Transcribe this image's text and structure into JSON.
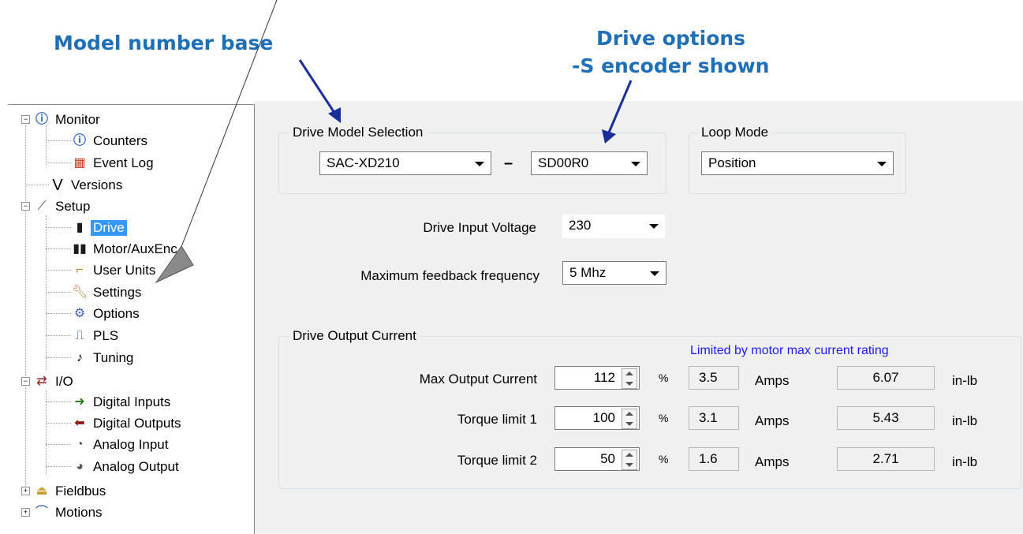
{
  "annotations": {
    "model_base": "Model number base",
    "drive_options_line1": "Drive options",
    "drive_options_line2": "-S encoder shown"
  },
  "tree": {
    "monitor": "Monitor",
    "counters": "Counters",
    "event_log": "Event Log",
    "versions": "Versions",
    "setup": "Setup",
    "drive": "Drive",
    "motor_auxenc": "Motor/AuxEnc",
    "user_units": "User Units",
    "settings": "Settings",
    "options": "Options",
    "pls": "PLS",
    "tuning": "Tuning",
    "io": "I/O",
    "digital_inputs": "Digital Inputs",
    "digital_outputs": "Digital Outputs",
    "analog_input": "Analog Input",
    "analog_output": "Analog Output",
    "fieldbus": "Fieldbus",
    "motions": "Motions",
    "selected": "Drive"
  },
  "drive_model": {
    "title": "Drive Model Selection",
    "model": "SAC-XD210",
    "dash": "–",
    "option": "SD00R0"
  },
  "loop_mode": {
    "title": "Loop Mode",
    "value": "Position"
  },
  "input_voltage": {
    "label": "Drive Input Voltage",
    "value": "230"
  },
  "feedback_freq": {
    "label": "Maximum feedback frequency",
    "value": "5 Mhz"
  },
  "output_current": {
    "title": "Drive Output Current",
    "note": "Limited by motor max current rating",
    "note_color": "#1a1aff",
    "pct_unit": "%",
    "amps_unit": "Amps",
    "torque_unit": "in-lb",
    "rows": [
      {
        "label": "Max Output Current",
        "percent": "112",
        "amps": "3.5",
        "torque": "6.07"
      },
      {
        "label": "Torque limit 1",
        "percent": "100",
        "amps": "3.1",
        "torque": "5.43"
      },
      {
        "label": "Torque limit 2",
        "percent": "50",
        "amps": "1.6",
        "torque": "2.71"
      }
    ]
  },
  "colors": {
    "annotation": "#1f6fb8",
    "selection": "#3399ff"
  }
}
